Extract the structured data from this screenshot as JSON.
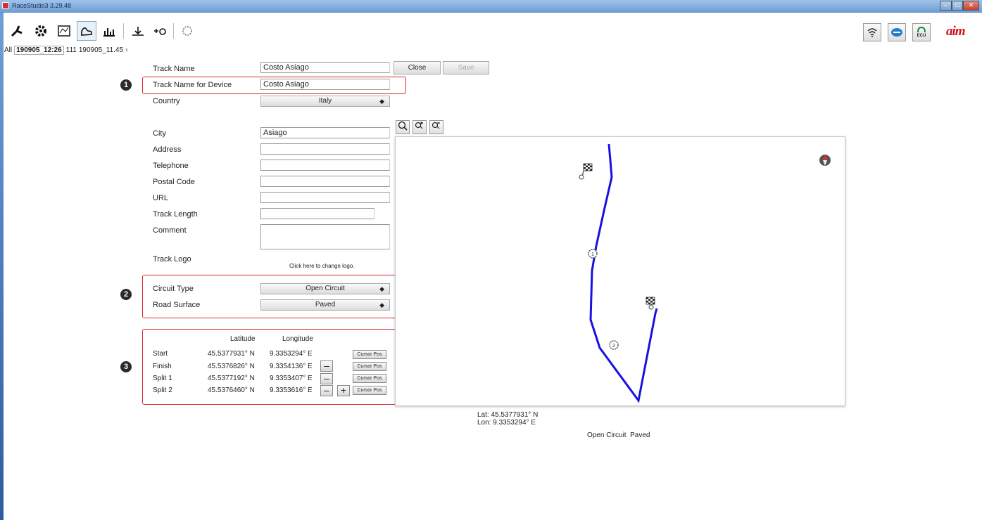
{
  "window": {
    "title": "RaceStudio3 3.29.48"
  },
  "toolbar": {
    "icons": [
      "wrench-icon",
      "gear-icon",
      "dashboard-icon",
      "track-icon",
      "chart-icon",
      "data-download-icon",
      "plus-device-icon",
      "track-settings-icon"
    ],
    "right_icons": [
      "wifi-icon",
      "can-icon",
      "ecu-icon"
    ],
    "ecu_label": "ECU",
    "brand_logo": "aim"
  },
  "tabs": {
    "all": "All",
    "active": "190905_12:26",
    "second": "111",
    "third": "190905_11.45",
    "close": "x"
  },
  "form": {
    "track_name_label": "Track Name",
    "track_name_value": "Costo Asiago",
    "close_label": "Close",
    "save_label": "Save",
    "device_name_label": "Track Name for Device",
    "device_name_value": "Costo Asiago",
    "country_label": "Country",
    "country_value": "Italy",
    "city_label": "City",
    "city_value": "Asiago",
    "address_label": "Address",
    "address_value": "",
    "telephone_label": "Telephone",
    "telephone_value": "",
    "postal_label": "Postal Code",
    "postal_value": "",
    "url_label": "URL",
    "url_value": "",
    "length_label": "Track Length",
    "length_value": "",
    "comment_label": "Comment",
    "comment_value": "",
    "logo_label": "Track Logo",
    "logo_hint": "Click here to change logo.",
    "circuit_type_label": "Circuit Type",
    "circuit_type_value": "Open Circuit",
    "road_surface_label": "Road Surface",
    "road_surface_value": "Paved"
  },
  "badges": [
    "1",
    "2",
    "3"
  ],
  "coordinates": {
    "lat_header": "Latitude",
    "lon_header": "Longitude",
    "cursor_label": "Cursor Pos",
    "rows": [
      {
        "name": "Start",
        "lat": "45.5377931° N",
        "lon": "9.3353294° E"
      },
      {
        "name": "Finish",
        "lat": "45.5376826° N",
        "lon": "9.3354136° E"
      },
      {
        "name": "Split 1",
        "lat": "45.5377192° N",
        "lon": "9.3353407° E"
      },
      {
        "name": "Split 2",
        "lat": "45.5376460° N",
        "lon": "9.3353616° E"
      }
    ]
  },
  "map": {
    "zoom_tools": [
      "zoom-fit-icon",
      "zoom-in-icon",
      "zoom-out-icon"
    ],
    "track_color": "#1a10e0",
    "lat_readout": "Lat: 45.5377931° N",
    "lon_readout": "Lon: 9.3353294° E",
    "summary": "Open Circuit  Paved"
  },
  "colors": {
    "highlight_box": "#d9262c",
    "brand": "#d0121b"
  }
}
